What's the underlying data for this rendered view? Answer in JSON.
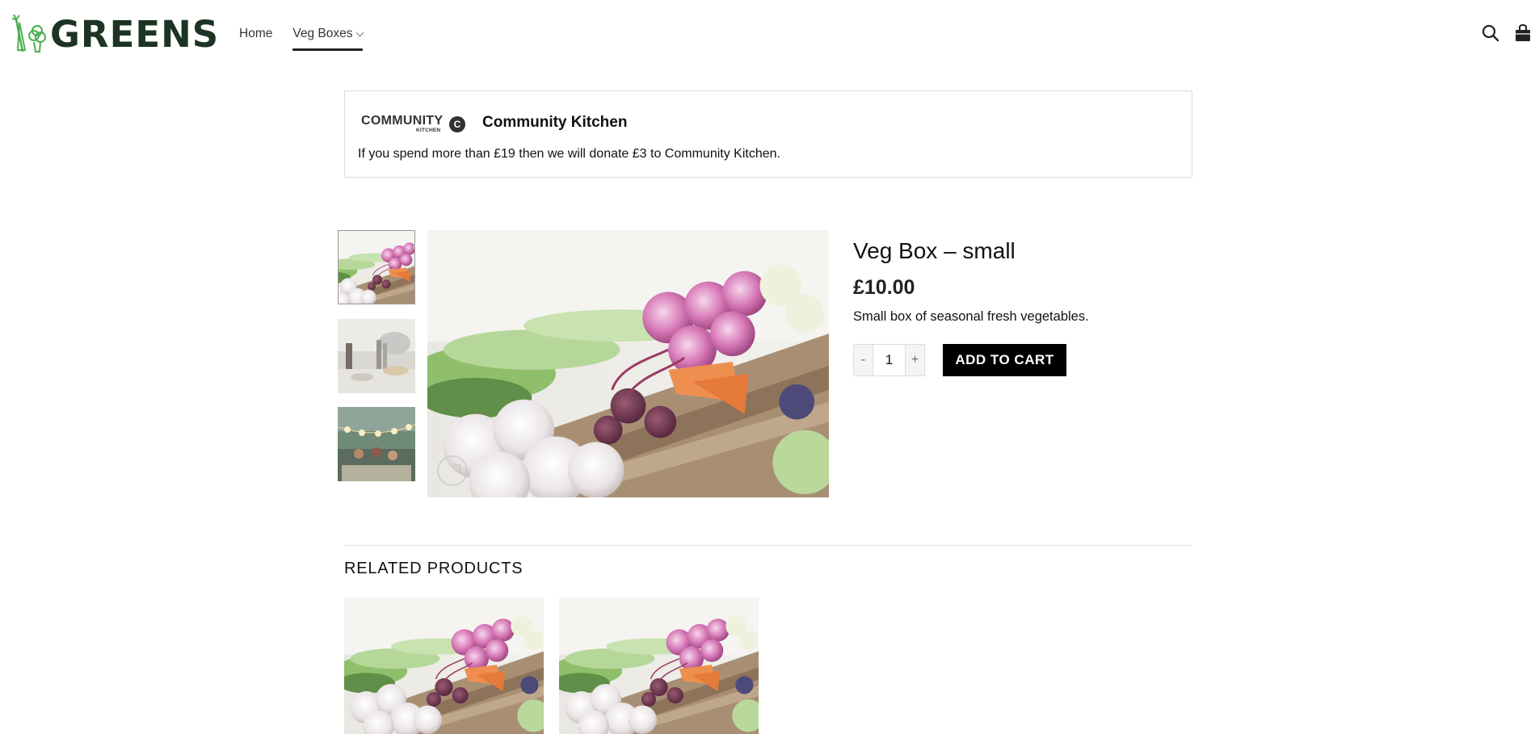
{
  "header": {
    "logo_text": "GREENS",
    "nav": [
      {
        "label": "Home"
      },
      {
        "label": "Veg Boxes"
      }
    ],
    "icons": {
      "search": "search-icon",
      "cart": "shopping-bag-icon"
    }
  },
  "notice": {
    "logo_word": "COMMUNITY",
    "logo_sub": "KITCHEN",
    "logo_badge": "C",
    "title": "Community Kitchen",
    "text": "If you spend more than £19 then we will donate £3 to Community Kitchen."
  },
  "product": {
    "title": "Veg Box – small",
    "price": "£10.00",
    "description": "Small box of seasonal fresh vegetables.",
    "quantity": "1",
    "minus": "-",
    "plus": "+",
    "add_to_cart": "ADD TO CART"
  },
  "gallery": {
    "thumbnails": [
      "veg-crate-photo",
      "dinner-table-photo",
      "festival-lights-photo"
    ],
    "zoom_icon": "expand-icon"
  },
  "related": {
    "title": "RELATED PRODUCTS"
  },
  "colors": {
    "brand": "#1d3425",
    "button": "#000000",
    "logo_green": "#4caf50"
  }
}
